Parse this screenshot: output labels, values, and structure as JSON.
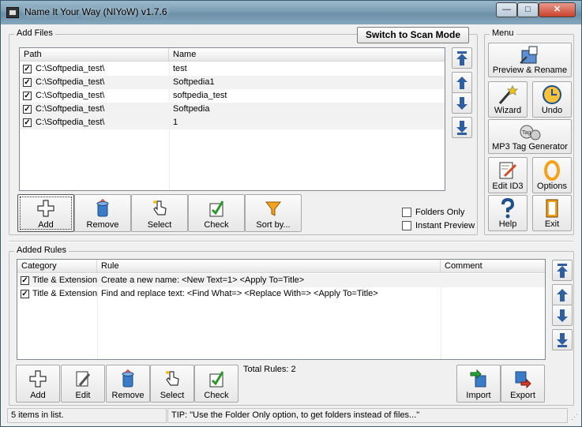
{
  "window": {
    "title": "Name It Your Way (NIYoW) v1.7.6",
    "minimize": "—",
    "maximize": "□",
    "close": "✕"
  },
  "add_files": {
    "legend": "Add Files",
    "scan_mode_button": "Switch to Scan Mode",
    "columns": [
      "Path",
      "Name"
    ],
    "rows": [
      {
        "path": "C:\\Softpedia_test\\",
        "name": "test",
        "checked": true
      },
      {
        "path": "C:\\Softpedia_test\\",
        "name": "Softpedia1",
        "checked": true
      },
      {
        "path": "C:\\Softpedia_test\\",
        "name": "softpedia_test",
        "checked": true
      },
      {
        "path": "C:\\Softpedia_test\\",
        "name": "Softpedia",
        "checked": true
      },
      {
        "path": "C:\\Softpedia_test\\",
        "name": "1",
        "checked": true
      }
    ],
    "buttons": {
      "add": "Add",
      "remove": "Remove",
      "select": "Select",
      "check": "Check",
      "sort": "Sort by..."
    },
    "folders_only": "Folders Only",
    "instant_preview": "Instant Preview"
  },
  "menu": {
    "legend": "Menu",
    "preview_rename": "Preview & Rename",
    "wizard": "Wizard",
    "undo": "Undo",
    "mp3": "MP3 Tag Generator",
    "edit_id3": "Edit ID3",
    "options": "Options",
    "help": "Help",
    "exit": "Exit",
    "tag_icon_text": "Tag"
  },
  "added_rules": {
    "legend": "Added Rules",
    "columns": [
      "Category",
      "Rule",
      "Comment"
    ],
    "rows": [
      {
        "category": "Title & Extension",
        "rule": "Create a new name: <New Text=1> <Apply To=Title>",
        "comment": "",
        "checked": true
      },
      {
        "category": "Title & Extension",
        "rule": "Find and replace text: <Find What=> <Replace With=> <Apply To=Title>",
        "comment": "",
        "checked": true
      }
    ],
    "buttons": {
      "add": "Add",
      "edit": "Edit",
      "remove": "Remove",
      "select": "Select",
      "check": "Check",
      "import": "Import",
      "export": "Export"
    },
    "total_rules": "Total Rules: 2"
  },
  "status": {
    "count": "5 items in list.",
    "tip": "TIP: \"Use the Folder Only option, to get folders instead of files...\""
  },
  "colors": {
    "check": "#1a1a1a",
    "arrow_blue": "#2f5f9e",
    "title_bar": "#7a9db3"
  }
}
